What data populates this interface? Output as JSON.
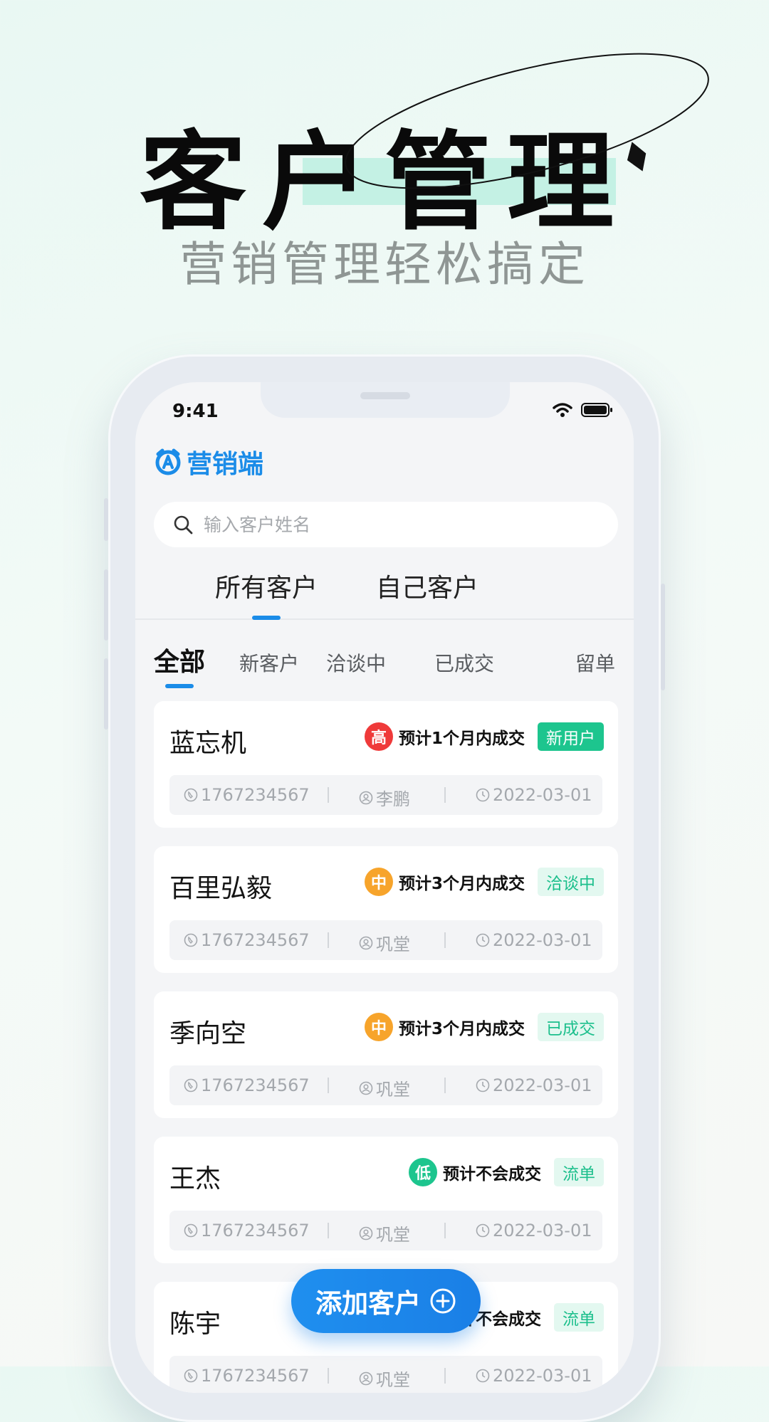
{
  "hero": {
    "title": "客户管理",
    "subtitle": "营销管理轻松搞定"
  },
  "status_bar": {
    "time": "9:41"
  },
  "app": {
    "name": "营销端"
  },
  "search": {
    "placeholder": "输入客户姓名",
    "value": ""
  },
  "main_tabs": [
    {
      "label": "所有客户",
      "active": true
    },
    {
      "label": "自己客户",
      "active": false
    }
  ],
  "filters": [
    {
      "label": "全部",
      "active": true
    },
    {
      "label": "新客户",
      "active": false
    },
    {
      "label": "洽谈中",
      "active": false
    },
    {
      "label": "已成交",
      "active": false
    },
    {
      "label": "留单",
      "active": false
    }
  ],
  "customers": [
    {
      "name": "蓝忘机",
      "level": "高",
      "level_color": "#ef3a3a",
      "expect": "预计1个月内成交",
      "status": "新用户",
      "status_bg": "#1dc58e",
      "status_fg": "#ffffff",
      "phone": "1767234567",
      "owner": "李鹏",
      "date": "2022-03-01"
    },
    {
      "name": "百里弘毅",
      "level": "中",
      "level_color": "#f7a42b",
      "expect": "预计3个月内成交",
      "status": "洽谈中",
      "status_bg": "#e3f8f0",
      "status_fg": "#1cbf8c",
      "phone": "1767234567",
      "owner": "巩堂",
      "date": "2022-03-01"
    },
    {
      "name": "季向空",
      "level": "中",
      "level_color": "#f7a42b",
      "expect": "预计3个月内成交",
      "status": "已成交",
      "status_bg": "#e3f8f0",
      "status_fg": "#1cbf8c",
      "phone": "1767234567",
      "owner": "巩堂",
      "date": "2022-03-01"
    },
    {
      "name": "王杰",
      "level": "低",
      "level_color": "#1dc58e",
      "expect": "预计不会成交",
      "status": "流单",
      "status_bg": "#e3f8f0",
      "status_fg": "#1cbf8c",
      "phone": "1767234567",
      "owner": "巩堂",
      "date": "2022-03-01"
    },
    {
      "name": "陈宇",
      "level": "低",
      "level_color": "#1dc58e",
      "expect": "预计不会成交",
      "status": "流单",
      "status_bg": "#e3f8f0",
      "status_fg": "#1cbf8c",
      "phone": "1767234567",
      "owner": "巩堂",
      "date": "2022-03-01"
    }
  ],
  "fab": {
    "label": "添加客户"
  },
  "colors": {
    "accent": "#1b8ce8",
    "text": "#141414",
    "muted": "#a4a8ad"
  }
}
